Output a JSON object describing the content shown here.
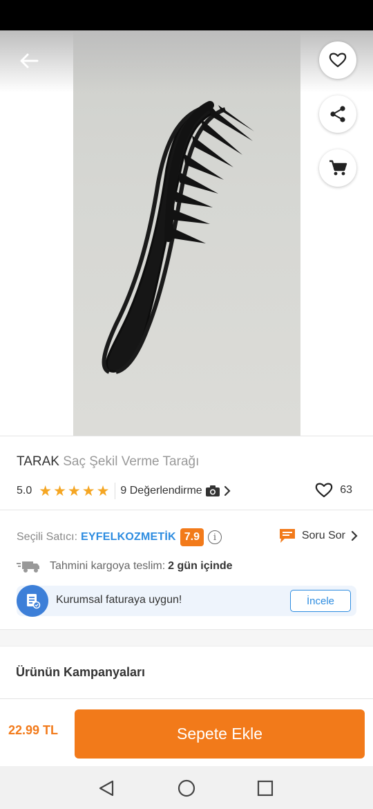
{
  "header": {
    "back_icon": "arrow-left-icon",
    "favorite_icon": "heart-outline-icon",
    "share_icon": "share-icon",
    "cart_icon": "shopping-cart-icon"
  },
  "product": {
    "image": "black wide-tooth shaping comb on grey background",
    "brand": "TARAK",
    "name": "Saç Şekil Verme Tarağı",
    "rating": "5.0",
    "stars": 5,
    "reviews_label": "9 Değerlendirme",
    "camera_icon": "camera-icon",
    "favorite_count": "63"
  },
  "seller": {
    "label": "Seçili Satıcı:",
    "name": "EYFELKOZMETİK",
    "score": "7.9",
    "ask_label": "Soru Sor"
  },
  "delivery": {
    "label": "Tahmini kargoya teslim:",
    "value": "2 gün içinde"
  },
  "corporate": {
    "label": "Kurumsal faturaya uygun!",
    "button": "İncele"
  },
  "campaigns": {
    "title": "Ürünün Kampanyaları"
  },
  "bottom": {
    "price": "22.99 TL",
    "add_to_cart": "Sepete Ekle"
  },
  "colors": {
    "accent": "#f27a1a",
    "seller_blue": "#2d8ce0",
    "star": "#f5a623"
  }
}
